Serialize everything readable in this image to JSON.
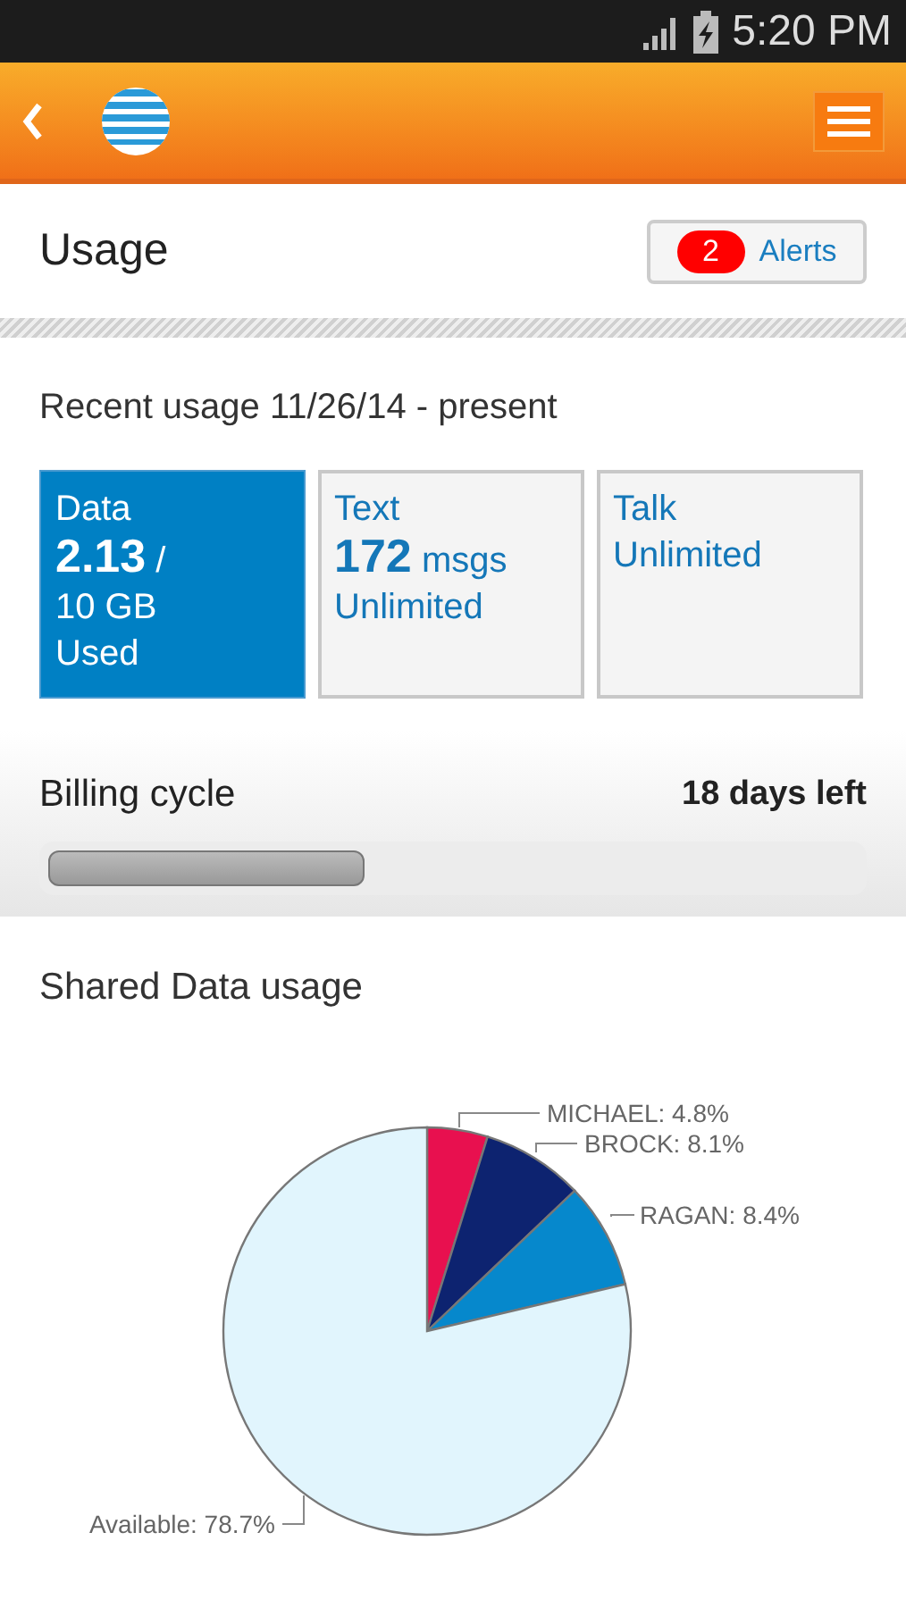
{
  "status_bar": {
    "time": "5:20 PM"
  },
  "page": {
    "title": "Usage",
    "alerts": {
      "count": "2",
      "label": "Alerts"
    }
  },
  "recent": {
    "title": "Recent usage 11/26/14 - present",
    "tiles": [
      {
        "label": "Data",
        "amount": "2.13",
        "suffix": "/",
        "lines": [
          "10 GB",
          "Used"
        ],
        "selected": true
      },
      {
        "label": "Text",
        "amount": "172",
        "suffix": "msgs",
        "lines": [
          "Unlimited"
        ],
        "selected": false
      },
      {
        "label": "Talk",
        "lines": [
          "Unlimited"
        ],
        "selected": false
      }
    ]
  },
  "billing": {
    "label": "Billing cycle",
    "remaining": "18 days left",
    "level": 0.39
  },
  "shared": {
    "title": "Shared Data usage",
    "label_separator": ":",
    "chart_data": {
      "type": "pie",
      "categories": [
        "MICHAEL",
        "BROCK",
        "RAGAN",
        "Available"
      ],
      "values": [
        4.8,
        8.1,
        8.4,
        78.7
      ],
      "colors": [
        "#e8104f",
        "#0d2370",
        "#0688cc",
        "#e1f5fd"
      ],
      "data_labels": true,
      "value_labels": [
        "4.8%",
        "8.1%",
        "8.4%",
        "78.7%"
      ]
    }
  }
}
